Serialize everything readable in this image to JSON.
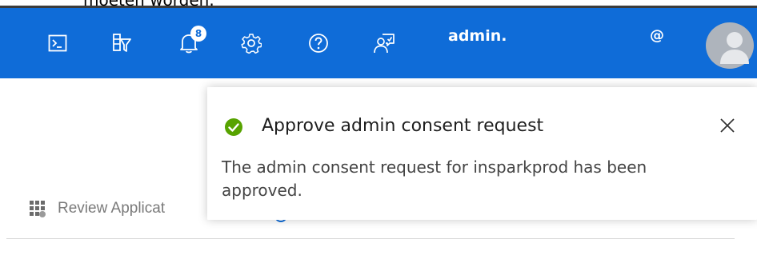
{
  "top_strip": {
    "cut_text": "moeten worden."
  },
  "header": {
    "background": "#0f6cd8",
    "icons": [
      "cloud-shell-icon",
      "directory-filter-icon",
      "notifications-icon",
      "settings-icon",
      "help-icon",
      "feedback-icon"
    ],
    "notification_count": "8",
    "user_label": "admin.",
    "tenant_label": "@"
  },
  "page": {
    "review_label": "Review Applicat"
  },
  "toast": {
    "title": "Approve admin consent request",
    "message": "The admin consent request for insparkprod has been approved.",
    "status_color": "#57a300"
  }
}
